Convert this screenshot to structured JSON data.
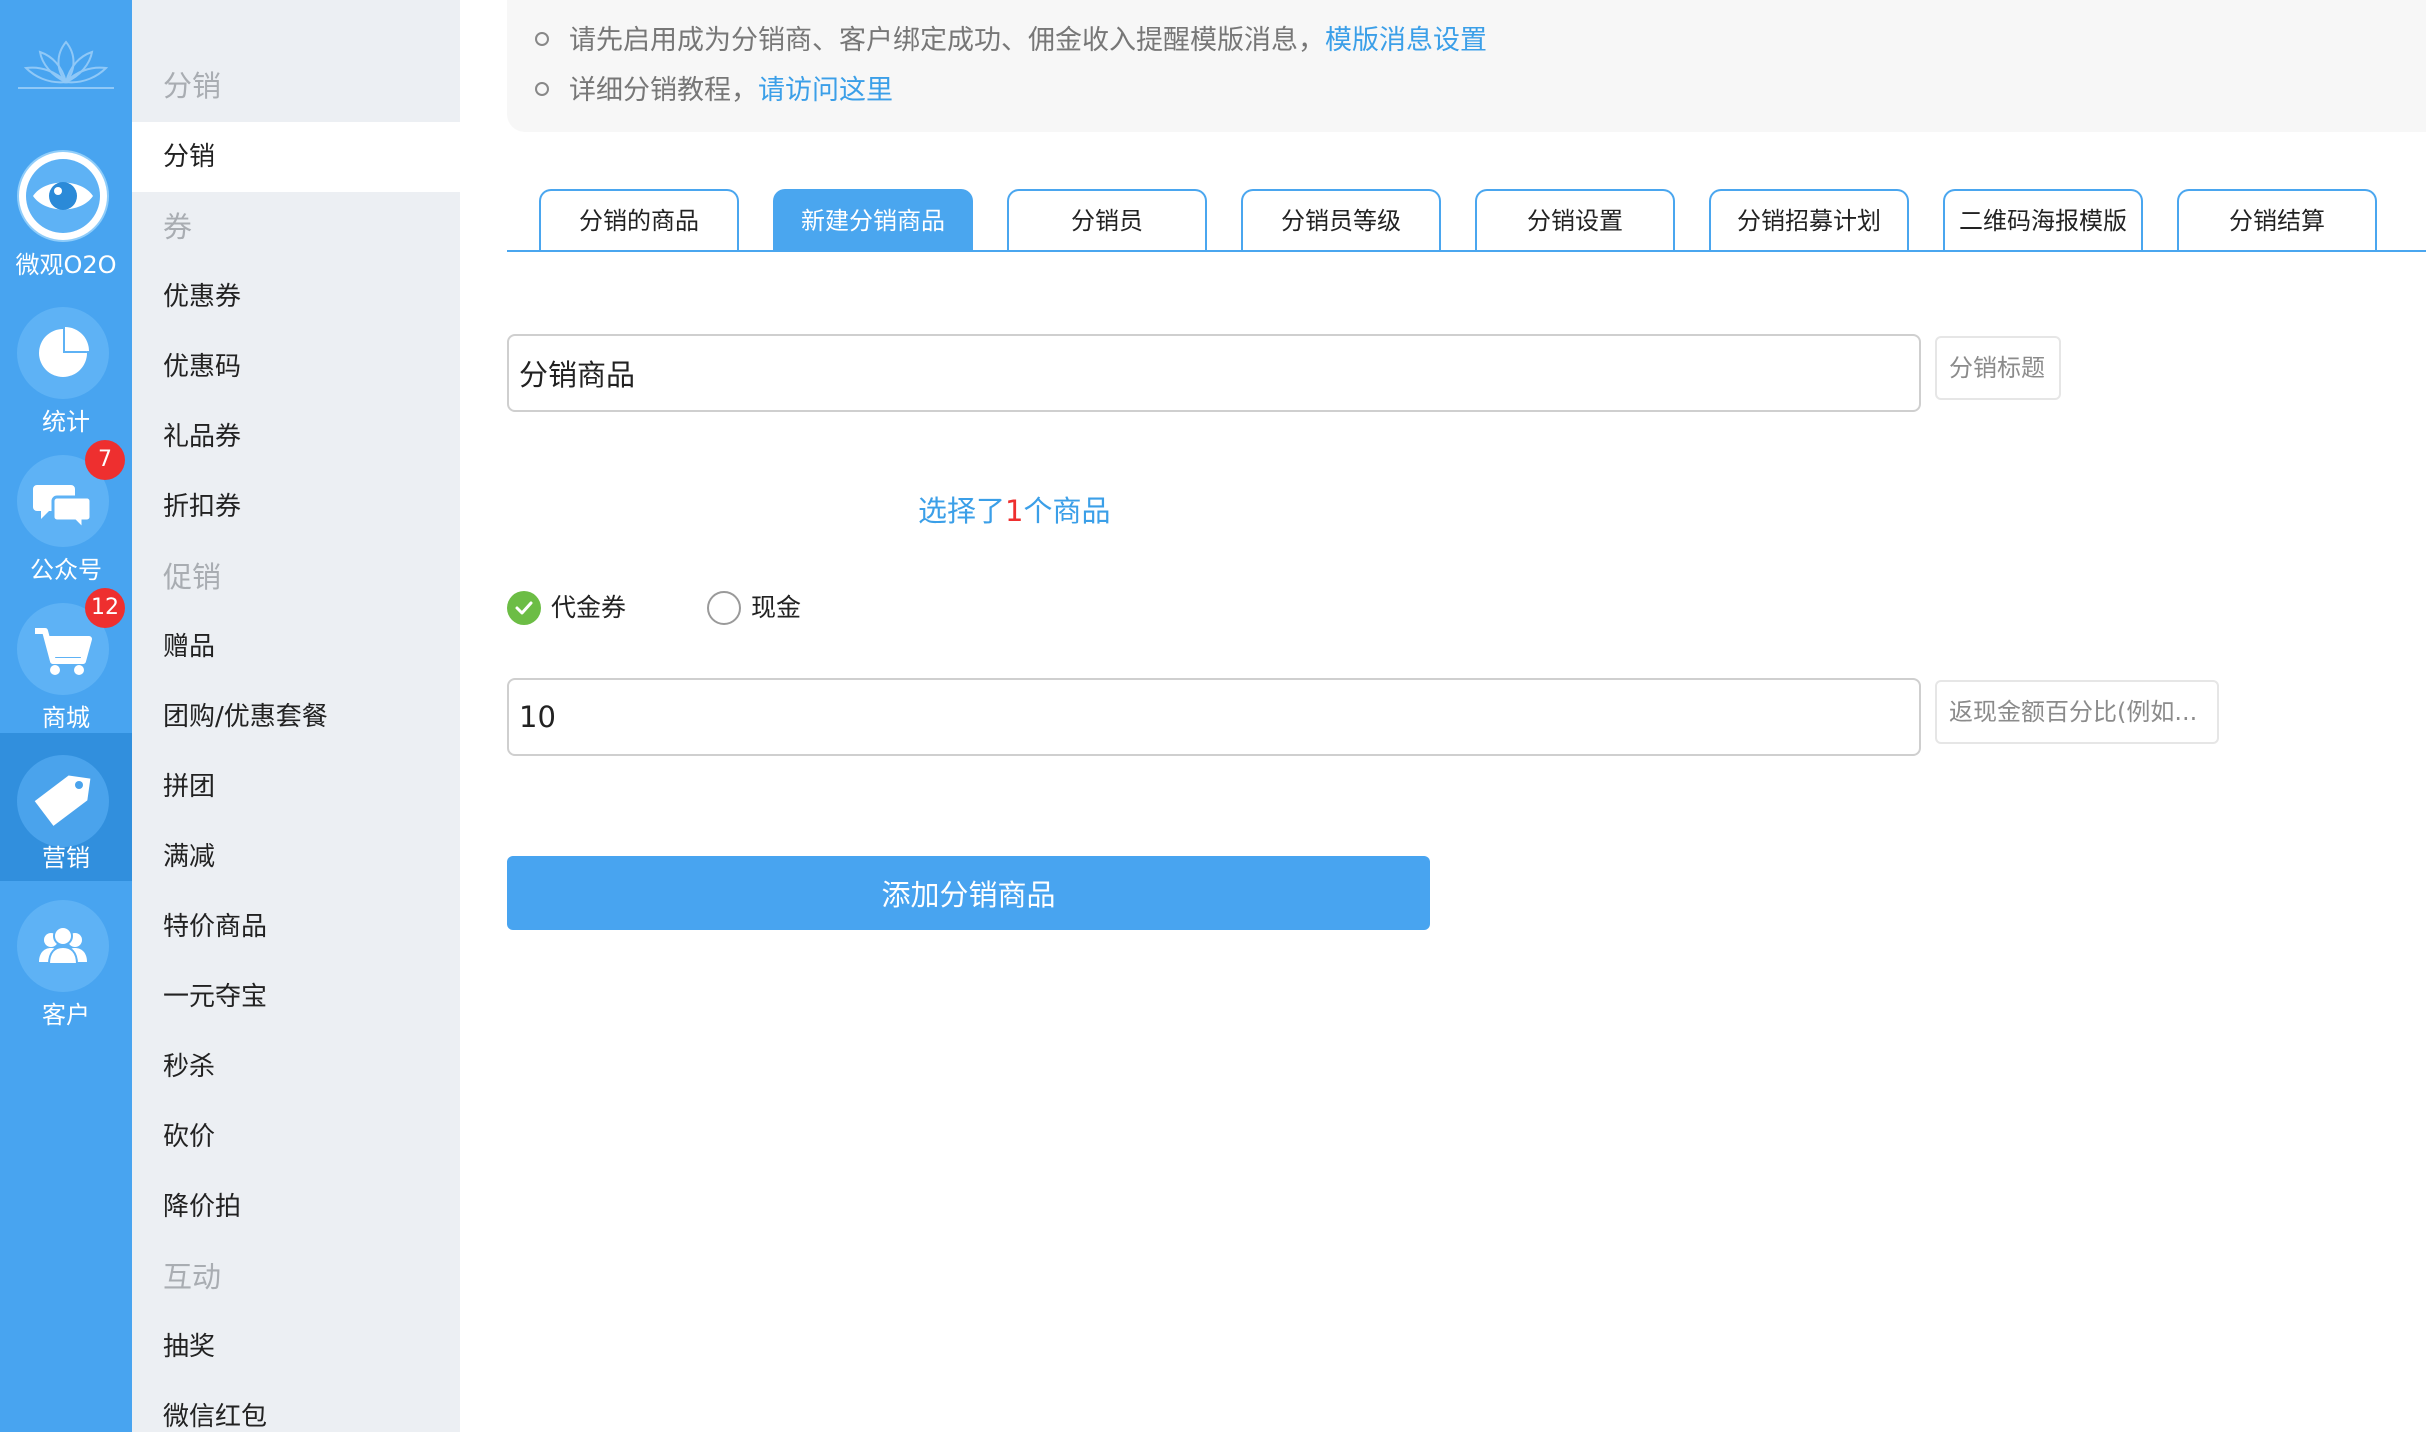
{
  "rail": {
    "items": [
      {
        "label": "微观O2O",
        "icon": "eye-icon"
      },
      {
        "label": "统计",
        "icon": "pie-chart-icon"
      },
      {
        "label": "公众号",
        "icon": "chat-bubbles-icon",
        "badge": "7"
      },
      {
        "label": "商城",
        "icon": "cart-icon",
        "badge": "12"
      },
      {
        "label": "营销",
        "icon": "tag-icon"
      },
      {
        "label": "客户",
        "icon": "users-icon"
      }
    ]
  },
  "submenu": {
    "rows": [
      {
        "label": "分销",
        "type": "head"
      },
      {
        "label": "分销",
        "type": "item",
        "active": true
      },
      {
        "label": "券",
        "type": "head"
      },
      {
        "label": "优惠券",
        "type": "item"
      },
      {
        "label": "优惠码",
        "type": "item"
      },
      {
        "label": "礼品券",
        "type": "item"
      },
      {
        "label": "折扣券",
        "type": "item"
      },
      {
        "label": "促销",
        "type": "head"
      },
      {
        "label": "赠品",
        "type": "item"
      },
      {
        "label": "团购/优惠套餐",
        "type": "item"
      },
      {
        "label": "拼团",
        "type": "item"
      },
      {
        "label": "满减",
        "type": "item"
      },
      {
        "label": "特价商品",
        "type": "item"
      },
      {
        "label": "一元夺宝",
        "type": "item"
      },
      {
        "label": "秒杀",
        "type": "item"
      },
      {
        "label": "砍价",
        "type": "item"
      },
      {
        "label": "降价拍",
        "type": "item"
      },
      {
        "label": "互动",
        "type": "head"
      },
      {
        "label": "抽奖",
        "type": "item"
      },
      {
        "label": "微信红包",
        "type": "item"
      }
    ]
  },
  "notice": {
    "line1_text": "请先启用成为分销商、客户绑定成功、佣金收入提醒模版消息，",
    "line1_link": "模版消息设置",
    "line2_text": "详细分销教程，",
    "line2_link": "请访问这里"
  },
  "tabs": [
    {
      "label": "分销的商品"
    },
    {
      "label": "新建分销商品",
      "active": true
    },
    {
      "label": "分销员"
    },
    {
      "label": "分销员等级"
    },
    {
      "label": "分销设置"
    },
    {
      "label": "分销招募计划"
    },
    {
      "label": "二维码海报模版"
    },
    {
      "label": "分销结算"
    }
  ],
  "form": {
    "title_value": "分销商品",
    "title_hint": "分销标题",
    "select_prefix": "选择了",
    "select_count": "1",
    "select_suffix": "个商品",
    "radio_voucher": "代金券",
    "radio_cash": "现金",
    "percent_value": "10",
    "percent_hint": "返现金额百分比(例如...",
    "submit_label": "添加分销商品"
  },
  "colors": {
    "accent": "#48a4f0",
    "rail_active": "#318fdd",
    "badge": "#ee2f2f",
    "check": "#6cbd45",
    "link": "#3b9fe8"
  }
}
